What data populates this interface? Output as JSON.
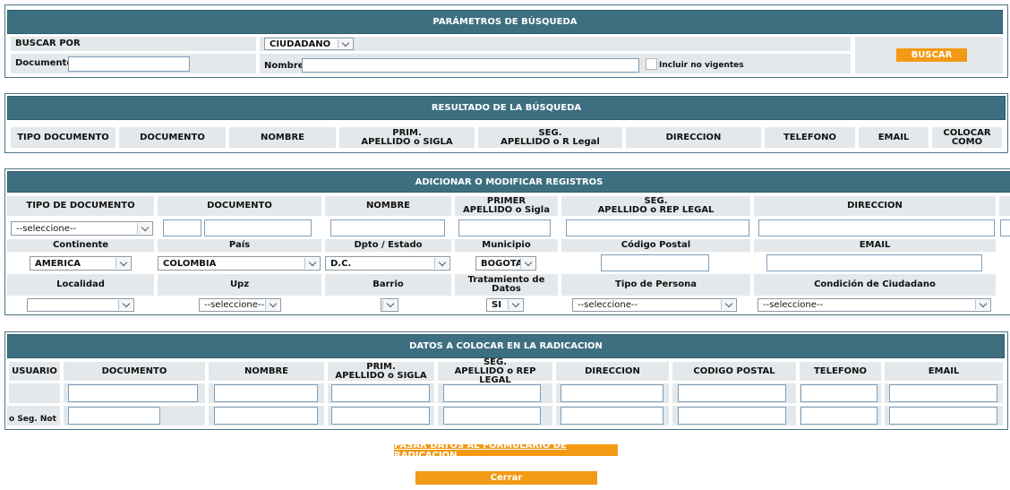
{
  "search": {
    "title": "PARÁMETROS DE BÚSQUEDA",
    "buscar_por_label": "BUSCAR POR",
    "buscar_por_value": "CIUDADANO",
    "documento_label": "Documento",
    "nombre_label": "Nombre",
    "incluir_label": "Incluir no vigentes",
    "buscar_button": "BUSCAR"
  },
  "results": {
    "title": "RESULTADO DE LA BÚSQUEDA",
    "columns": [
      "TIPO DOCUMENTO",
      "DOCUMENTO",
      "NOMBRE",
      "PRIM.",
      "APELLIDO o SIGLA",
      "SEG.",
      "APELLIDO o R Legal",
      "DIRECCION",
      "TELEFONO",
      "EMAIL",
      "COLOCAR",
      "COMO"
    ]
  },
  "add": {
    "title": "ADICIONAR O MODIFICAR REGISTROS",
    "headers": [
      "TIPO DE DOCUMENTO",
      "DOCUMENTO",
      "NOMBRE",
      "PRIMER",
      "APELLIDO o Sigla",
      "SEG.",
      "APELLIDO o REP LEGAL",
      "DIRECCION"
    ],
    "tipo_doc_value": "--seleccione--",
    "row2_labels": [
      "Continente",
      "País",
      "Dpto / Estado",
      "Municipio",
      "Código Postal",
      "EMAIL"
    ],
    "continente_value": "AMERICA",
    "pais_value": "COLOMBIA",
    "dpto_value": "D.C.",
    "municipio_value": "BOGOTA",
    "row3_labels": [
      "Localidad",
      "Upz",
      "Barrio",
      "Tratamiento de",
      "Datos",
      "Tipo de Persona",
      "Condición de Ciudadano"
    ],
    "localidad_value": "",
    "upz_value": "--seleccione--",
    "barrio_value": "",
    "tratamiento_value": "SI",
    "tipo_persona_value": "--seleccione--",
    "condicion_value": "--seleccione--"
  },
  "radicacion": {
    "title": "DATOS A COLOCAR EN LA RADICACION",
    "headers": [
      "USUARIO",
      "DOCUMENTO",
      "NOMBRE",
      "PRIM.",
      "APELLIDO o SIGLA",
      "SEG.",
      "APELLIDO o REP LEGAL",
      "DIRECCION",
      "CODIGO POSTAL",
      "TELEFONO",
      "EMAIL"
    ],
    "row2_label": "o Seg. Not"
  },
  "footer": {
    "pasar_link": "PASAR DATOS AL FORMULARIO DE RADICACION",
    "cerrar_button": "Cerrar"
  },
  "colors": {
    "header_bar": "#3e6f80",
    "button": "#f39a14",
    "cell_bg": "#e4e8eb"
  }
}
